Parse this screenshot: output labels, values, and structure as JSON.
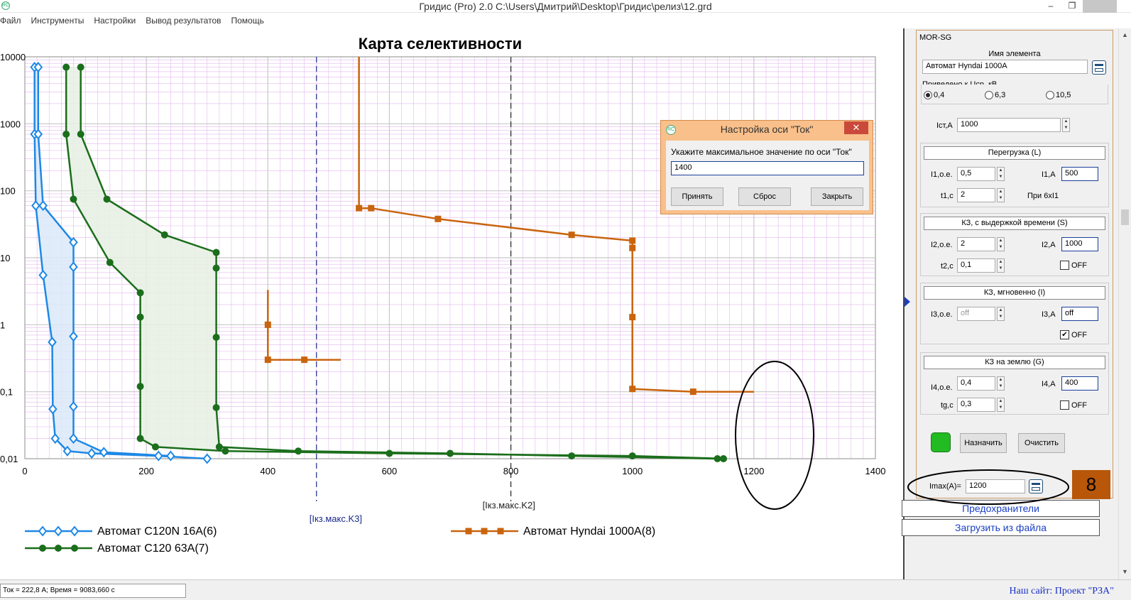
{
  "window": {
    "title": "Гридис (Pro) 2.0  C:\\Users\\Дмитрий\\Desktop\\Гридис\\релиз\\12.grd",
    "app_icon": "RC",
    "minimize_label": "–",
    "restore_label": "❐",
    "close_label": ""
  },
  "menu": [
    "Файл",
    "Инструменты",
    "Настройки",
    "Вывод результатов",
    "Помощь"
  ],
  "chart_data": {
    "type": "line",
    "title": "Карта селективности",
    "x_scale": "linear",
    "y_scale": "log",
    "xlim": [
      0,
      1400
    ],
    "ylim": [
      0.01,
      10000
    ],
    "x_ticks": [
      "0",
      "200",
      "400",
      "600",
      "800",
      "1000",
      "1200",
      "1400"
    ],
    "y_ticks": [
      "0,01",
      "0,1",
      "1",
      "10",
      "100",
      "1000",
      "10000"
    ],
    "markers": [
      {
        "label": "[Iкз.макс.K3]",
        "x": 480,
        "color": "#1a2a8a"
      },
      {
        "label": "[Iкз.макс.K2]",
        "x": 800,
        "color": "#222222"
      }
    ],
    "series": [
      {
        "name": "Автомат C120N 16A(6)",
        "color": "#1e88e5",
        "marker": "diamond",
        "fill": "#dbe9f8",
        "lower": [
          [
            16,
            7000
          ],
          [
            16,
            700
          ],
          [
            18,
            60
          ],
          [
            30,
            5.5
          ],
          [
            45,
            0.55
          ],
          [
            46,
            0.055
          ],
          [
            50,
            0.02
          ],
          [
            70,
            0.013
          ],
          [
            110,
            0.012
          ],
          [
            220,
            0.011
          ],
          [
            300,
            0.01
          ]
        ],
        "upper": [
          [
            22,
            7000
          ],
          [
            22,
            700
          ],
          [
            30,
            60
          ],
          [
            80,
            17
          ],
          [
            80,
            7.3
          ],
          [
            80,
            0.67
          ],
          [
            80,
            0.06
          ],
          [
            80,
            0.02
          ],
          [
            130,
            0.0125
          ],
          [
            240,
            0.011
          ]
        ]
      },
      {
        "name": "Автомат C120 63A(7)",
        "color": "#1b6e1b",
        "marker": "circle",
        "fill": "#e6f0e3",
        "lower": [
          [
            68,
            7000
          ],
          [
            68,
            700
          ],
          [
            80,
            75
          ],
          [
            140,
            8.5
          ],
          [
            190,
            3
          ],
          [
            190,
            1.3
          ],
          [
            190,
            0.12
          ],
          [
            190,
            0.02
          ],
          [
            215,
            0.015
          ],
          [
            330,
            0.013
          ],
          [
            600,
            0.012
          ],
          [
            1000,
            0.011
          ],
          [
            1150,
            0.01
          ]
        ],
        "upper": [
          [
            92,
            7000
          ],
          [
            92,
            700
          ],
          [
            135,
            75
          ],
          [
            230,
            22
          ],
          [
            315,
            12
          ],
          [
            315,
            7
          ],
          [
            315,
            0.65
          ],
          [
            315,
            0.058
          ],
          [
            320,
            0.015
          ],
          [
            450,
            0.013
          ],
          [
            700,
            0.012
          ],
          [
            900,
            0.011
          ],
          [
            1140,
            0.01
          ]
        ]
      },
      {
        "name": "Автомат Hyndai 1000A(8)",
        "color": "#c9640e",
        "marker": "square",
        "points": [
          [
            550,
            10000
          ],
          [
            550,
            55
          ],
          [
            570,
            55
          ],
          [
            680,
            38
          ],
          [
            900,
            22
          ],
          [
            1000,
            18
          ],
          [
            1000,
            14
          ],
          [
            1000,
            1.3
          ],
          [
            1000,
            0.11
          ],
          [
            1100,
            0.1
          ],
          [
            1200,
            0.1
          ]
        ],
        "points2": [
          [
            400,
            3.3
          ],
          [
            400,
            1
          ],
          [
            400,
            0.3
          ],
          [
            460,
            0.3
          ],
          [
            520,
            0.3
          ]
        ]
      }
    ],
    "legend": "bottom"
  },
  "annotation": {
    "ellipse_label": ""
  },
  "dialog": {
    "title": "Настройка оси \"Ток\"",
    "prompt": "Укажите максимальное значение по оси \"Ток\"",
    "value": "1400",
    "accept": "Принять",
    "reset": "Сброс",
    "close": "Закрыть",
    "close_x": "✕"
  },
  "panel": {
    "header": "MOR-SG",
    "name_label": "Имя элемента",
    "name_value": "Автомат Hyndai 1000A",
    "voltage_label": "Приведено к Ucp, кВ",
    "voltages": [
      "0,4",
      "6,3",
      "10,5"
    ],
    "voltage_selected": "0,4",
    "ist_label": "Iст,А",
    "ist_value": "1000",
    "overload": {
      "title": "Перегрузка (L)",
      "i1oe_label": "I1,o.e.",
      "i1oe_value": "0,5",
      "i1a_label": "I1,A",
      "i1a_value": "500",
      "t1_label": "t1,c",
      "t1_value": "2",
      "note": "При 6хI1"
    },
    "short_delay": {
      "title": "КЗ, с выдержкой времени (S)",
      "i2oe_label": "I2,o.e.",
      "i2oe_value": "2",
      "i2a_label": "I2,A",
      "i2a_value": "1000",
      "t2_label": "t2,c",
      "t2_value": "0,1",
      "off_label": "OFF",
      "off_checked": false
    },
    "instant": {
      "title": "КЗ, мгновенно (I)",
      "i3oe_label": "I3,o.e.",
      "i3oe_value": "off",
      "i3a_label": "I3,A",
      "i3a_value": "off",
      "off_label": "OFF",
      "off_checked": true
    },
    "ground": {
      "title": "КЗ на землю (G)",
      "i4oe_label": "I4,o.e.",
      "i4oe_value": "0,4",
      "i4a_label": "I4,A",
      "i4a_value": "400",
      "tg_label": "tg,c",
      "tg_value": "0,3",
      "off_label": "OFF",
      "off_checked": false
    },
    "color_swatch": "#22bb22",
    "assign": "Назначить",
    "clear": "Очистить",
    "imax_label": "Imax(A)=",
    "imax_value": "1200",
    "badge": "8",
    "fuses": "Предохранители",
    "load_file": "Загрузить из файла"
  },
  "status": {
    "readout": "Ток = 222,8 А; Время = 9083,660 с",
    "site": "Наш сайт: Проект \"РЗА\""
  }
}
